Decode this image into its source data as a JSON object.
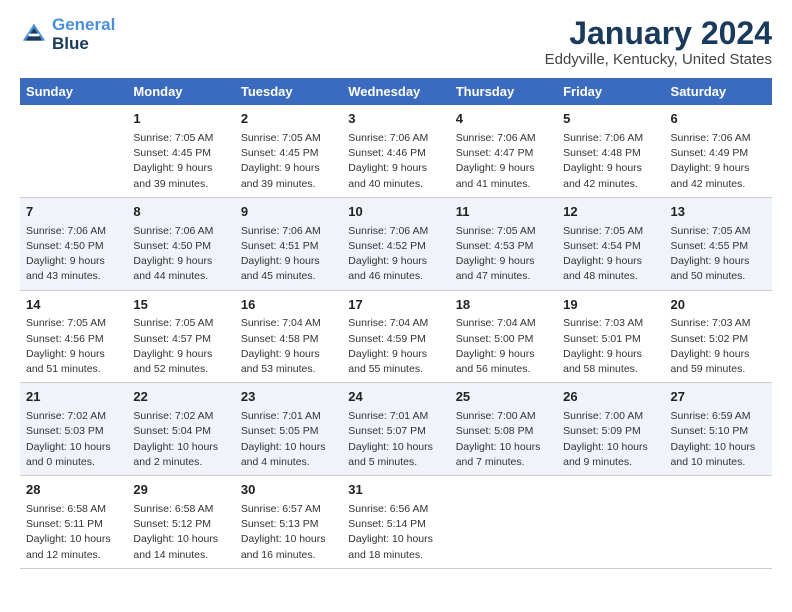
{
  "header": {
    "logo_line1": "General",
    "logo_line2": "Blue",
    "main_title": "January 2024",
    "subtitle": "Eddyville, Kentucky, United States"
  },
  "columns": [
    "Sunday",
    "Monday",
    "Tuesday",
    "Wednesday",
    "Thursday",
    "Friday",
    "Saturday"
  ],
  "rows": [
    [
      {
        "day": "",
        "lines": []
      },
      {
        "day": "1",
        "lines": [
          "Sunrise: 7:05 AM",
          "Sunset: 4:45 PM",
          "Daylight: 9 hours",
          "and 39 minutes."
        ]
      },
      {
        "day": "2",
        "lines": [
          "Sunrise: 7:05 AM",
          "Sunset: 4:45 PM",
          "Daylight: 9 hours",
          "and 39 minutes."
        ]
      },
      {
        "day": "3",
        "lines": [
          "Sunrise: 7:06 AM",
          "Sunset: 4:46 PM",
          "Daylight: 9 hours",
          "and 40 minutes."
        ]
      },
      {
        "day": "4",
        "lines": [
          "Sunrise: 7:06 AM",
          "Sunset: 4:47 PM",
          "Daylight: 9 hours",
          "and 41 minutes."
        ]
      },
      {
        "day": "5",
        "lines": [
          "Sunrise: 7:06 AM",
          "Sunset: 4:48 PM",
          "Daylight: 9 hours",
          "and 42 minutes."
        ]
      },
      {
        "day": "6",
        "lines": [
          "Sunrise: 7:06 AM",
          "Sunset: 4:49 PM",
          "Daylight: 9 hours",
          "and 42 minutes."
        ]
      }
    ],
    [
      {
        "day": "7",
        "lines": [
          "Sunrise: 7:06 AM",
          "Sunset: 4:50 PM",
          "Daylight: 9 hours",
          "and 43 minutes."
        ]
      },
      {
        "day": "8",
        "lines": [
          "Sunrise: 7:06 AM",
          "Sunset: 4:50 PM",
          "Daylight: 9 hours",
          "and 44 minutes."
        ]
      },
      {
        "day": "9",
        "lines": [
          "Sunrise: 7:06 AM",
          "Sunset: 4:51 PM",
          "Daylight: 9 hours",
          "and 45 minutes."
        ]
      },
      {
        "day": "10",
        "lines": [
          "Sunrise: 7:06 AM",
          "Sunset: 4:52 PM",
          "Daylight: 9 hours",
          "and 46 minutes."
        ]
      },
      {
        "day": "11",
        "lines": [
          "Sunrise: 7:05 AM",
          "Sunset: 4:53 PM",
          "Daylight: 9 hours",
          "and 47 minutes."
        ]
      },
      {
        "day": "12",
        "lines": [
          "Sunrise: 7:05 AM",
          "Sunset: 4:54 PM",
          "Daylight: 9 hours",
          "and 48 minutes."
        ]
      },
      {
        "day": "13",
        "lines": [
          "Sunrise: 7:05 AM",
          "Sunset: 4:55 PM",
          "Daylight: 9 hours",
          "and 50 minutes."
        ]
      }
    ],
    [
      {
        "day": "14",
        "lines": [
          "Sunrise: 7:05 AM",
          "Sunset: 4:56 PM",
          "Daylight: 9 hours",
          "and 51 minutes."
        ]
      },
      {
        "day": "15",
        "lines": [
          "Sunrise: 7:05 AM",
          "Sunset: 4:57 PM",
          "Daylight: 9 hours",
          "and 52 minutes."
        ]
      },
      {
        "day": "16",
        "lines": [
          "Sunrise: 7:04 AM",
          "Sunset: 4:58 PM",
          "Daylight: 9 hours",
          "and 53 minutes."
        ]
      },
      {
        "day": "17",
        "lines": [
          "Sunrise: 7:04 AM",
          "Sunset: 4:59 PM",
          "Daylight: 9 hours",
          "and 55 minutes."
        ]
      },
      {
        "day": "18",
        "lines": [
          "Sunrise: 7:04 AM",
          "Sunset: 5:00 PM",
          "Daylight: 9 hours",
          "and 56 minutes."
        ]
      },
      {
        "day": "19",
        "lines": [
          "Sunrise: 7:03 AM",
          "Sunset: 5:01 PM",
          "Daylight: 9 hours",
          "and 58 minutes."
        ]
      },
      {
        "day": "20",
        "lines": [
          "Sunrise: 7:03 AM",
          "Sunset: 5:02 PM",
          "Daylight: 9 hours",
          "and 59 minutes."
        ]
      }
    ],
    [
      {
        "day": "21",
        "lines": [
          "Sunrise: 7:02 AM",
          "Sunset: 5:03 PM",
          "Daylight: 10 hours",
          "and 0 minutes."
        ]
      },
      {
        "day": "22",
        "lines": [
          "Sunrise: 7:02 AM",
          "Sunset: 5:04 PM",
          "Daylight: 10 hours",
          "and 2 minutes."
        ]
      },
      {
        "day": "23",
        "lines": [
          "Sunrise: 7:01 AM",
          "Sunset: 5:05 PM",
          "Daylight: 10 hours",
          "and 4 minutes."
        ]
      },
      {
        "day": "24",
        "lines": [
          "Sunrise: 7:01 AM",
          "Sunset: 5:07 PM",
          "Daylight: 10 hours",
          "and 5 minutes."
        ]
      },
      {
        "day": "25",
        "lines": [
          "Sunrise: 7:00 AM",
          "Sunset: 5:08 PM",
          "Daylight: 10 hours",
          "and 7 minutes."
        ]
      },
      {
        "day": "26",
        "lines": [
          "Sunrise: 7:00 AM",
          "Sunset: 5:09 PM",
          "Daylight: 10 hours",
          "and 9 minutes."
        ]
      },
      {
        "day": "27",
        "lines": [
          "Sunrise: 6:59 AM",
          "Sunset: 5:10 PM",
          "Daylight: 10 hours",
          "and 10 minutes."
        ]
      }
    ],
    [
      {
        "day": "28",
        "lines": [
          "Sunrise: 6:58 AM",
          "Sunset: 5:11 PM",
          "Daylight: 10 hours",
          "and 12 minutes."
        ]
      },
      {
        "day": "29",
        "lines": [
          "Sunrise: 6:58 AM",
          "Sunset: 5:12 PM",
          "Daylight: 10 hours",
          "and 14 minutes."
        ]
      },
      {
        "day": "30",
        "lines": [
          "Sunrise: 6:57 AM",
          "Sunset: 5:13 PM",
          "Daylight: 10 hours",
          "and 16 minutes."
        ]
      },
      {
        "day": "31",
        "lines": [
          "Sunrise: 6:56 AM",
          "Sunset: 5:14 PM",
          "Daylight: 10 hours",
          "and 18 minutes."
        ]
      },
      {
        "day": "",
        "lines": []
      },
      {
        "day": "",
        "lines": []
      },
      {
        "day": "",
        "lines": []
      }
    ]
  ]
}
